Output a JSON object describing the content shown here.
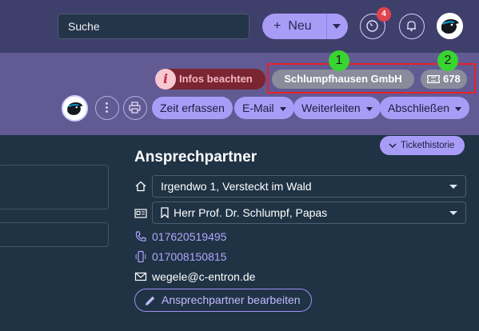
{
  "topbar": {
    "search_value": "Suche",
    "new_button": {
      "icon": "+",
      "label": "Neu"
    },
    "timer_badge": "4",
    "icons": [
      "clock-icon",
      "bell-icon",
      "avatar-panther"
    ]
  },
  "subbar": {
    "info_icon": "i",
    "info_label": "Infos beachten",
    "company": "Schlumpfhausen GmbH",
    "ticket_number": "678",
    "markers": [
      "1",
      "2"
    ],
    "actions": [
      {
        "label": "Zeit erfassen"
      },
      {
        "label": "E-Mail"
      },
      {
        "label": "Weiterleiten"
      },
      {
        "label": "Abschließen"
      }
    ],
    "history_button": "Tickethistorie"
  },
  "contact": {
    "title": "Ansprechpartner",
    "address": "Irgendwo 1, Versteckt im Wald",
    "person": "Herr Prof. Dr. Schlumpf, Papas",
    "phone": "017620519495",
    "mobile": "017008150815",
    "email": "wegele@c-entron.de",
    "edit_button": "Ansprechpartner bearbeiten"
  },
  "colors": {
    "accent": "#a99cf7",
    "topbar": "#3f3f6b",
    "subbar": "#625a93",
    "body": "#1f3344",
    "highlight_box": "#e8202a",
    "marker": "#38d431",
    "info": "#7a2531"
  }
}
